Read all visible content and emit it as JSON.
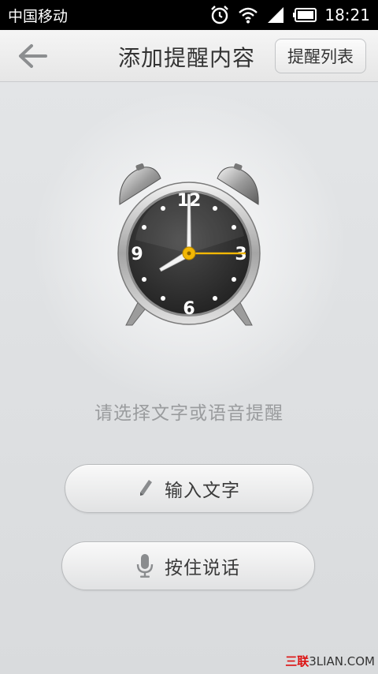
{
  "status_bar": {
    "carrier": "中国移动",
    "time": "18:21",
    "icons": [
      "alarm-icon",
      "wifi-icon",
      "signal-icon",
      "battery-icon"
    ]
  },
  "header": {
    "title": "添加提醒内容",
    "list_button": "提醒列表",
    "back_icon": "back-arrow-icon"
  },
  "clock": {
    "numerals": {
      "top": "12",
      "right": "3",
      "bottom": "6",
      "left": "9"
    },
    "hour": 8,
    "minute": 0,
    "second": 15,
    "second_hand_color": "#f2b705"
  },
  "main": {
    "hint": "请选择文字或语音提醒",
    "text_button": {
      "label": "输入文字",
      "icon": "pencil-icon"
    },
    "voice_button": {
      "label": "按住说话",
      "icon": "microphone-icon"
    }
  },
  "watermark": {
    "part1": "三联",
    "part2": "3LIAN.COM"
  }
}
